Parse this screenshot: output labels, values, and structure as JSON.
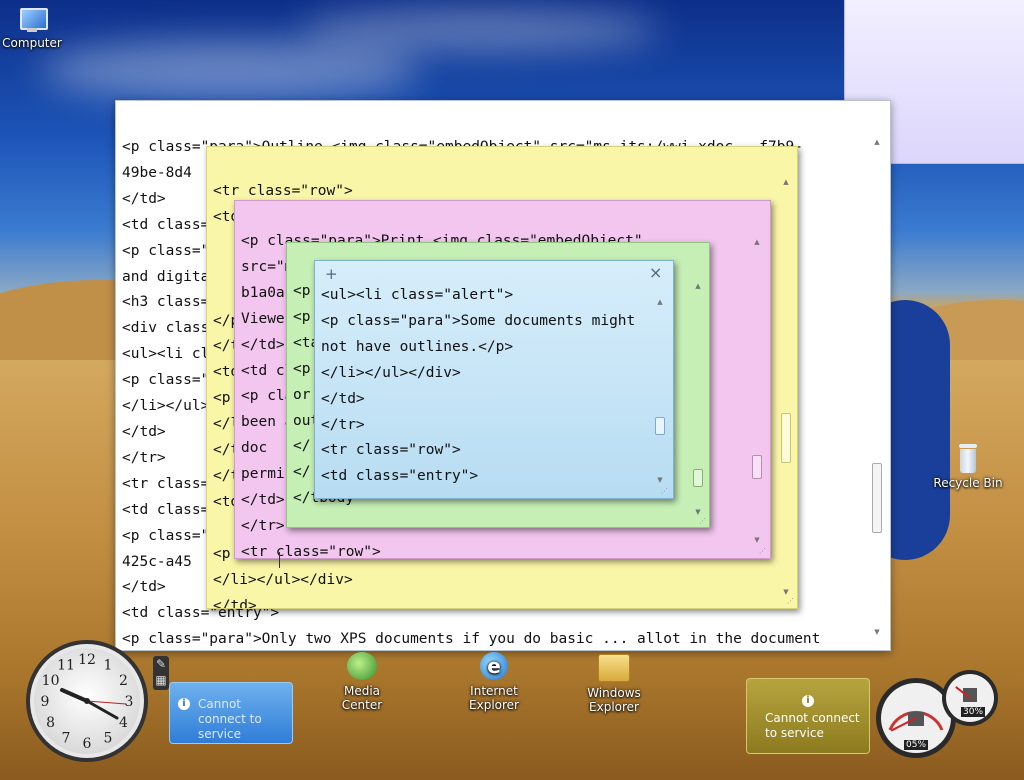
{
  "desktop": {
    "icons": {
      "computer": "Computer",
      "recycle_bin": "Recycle Bin",
      "media_center": "Media Center",
      "internet_explorer": "Internet Explorer",
      "windows_explorer": "Windows Explorer"
    }
  },
  "main_window": {
    "lines": [
      "<p class=\"para\">Outline <img class=\"embedObject\" src=\"ms-its:/wwi.xdoc...f7b9-",
      "49be-8d4                                                              p>",
      "</td>",
      "<td class=\"e",
      "<p class=\"pa                                                          results",
      "and digital",
      "<h3 class=\"",
      "<div class=\"",
      "<ul><li clas",
      "<p class=\"pa",
      "</li></ul></",
      "</td>",
      "</tr>",
      "<tr class=\"r",
      "<td class=\"e",
      "<p class=\"pa                                                       f37f-",
      "425c-a45",
      "</td>",
      "<td class=\"entry\">",
      "<p class=\"para\">Only two XPS documents if you do basic ... allot in the document"
    ]
  },
  "note_yellow": {
    "lines": [
      "<tr class=\"row\">",
      "<td",
      "",
      "",
      "",
      "</p",
      "</t",
      "<td",
      "<p",
      "</l",
      "</td",
      "</tr",
      "<td",
      "",
      "<p",
      "</li></ul></div>",
      "</td>"
    ]
  },
  "note_pink": {
    "lines": [
      "<p class=\"para\">Print <img class=\"embedObject\"",
      "src=\"m",
      "b1a0a",
      "Viewe",
      "</td>",
      "<td cl",
      "<p cla",
      "been a",
      "doc",
      "permi",
      "</td>",
      "</tr>",
      "<tr class=\"row\">"
    ]
  },
  "note_green": {
    "lines": [
      "<p",
      "<p",
      "<ta",
      "<p",
      "or",
      "out",
      "</",
      "</",
      "</tbody"
    ]
  },
  "note_blue": {
    "add_label": "+",
    "close_label": "×",
    "lines": [
      "<ul><li class=\"alert\">",
      "<p class=\"para\">Some documents might",
      "not have outlines.</p>",
      "</li></ul></div>",
      "</td>",
      "</tr>",
      "<tr class=\"row\">",
      "<td class=\"entry\">"
    ]
  },
  "gadgets": {
    "feed_left": {
      "info_icon": "i",
      "message": "Cannot connect to service"
    },
    "feed_right": {
      "info_icon": "i",
      "message": "Cannot connect to service"
    },
    "cpu_meter": {
      "cpu_percent": "05%",
      "ram_percent": "30%",
      "cpu_value": 0.05,
      "ram_value": 0.3
    },
    "clock": {
      "numerals": [
        "12",
        "1",
        "2",
        "3",
        "4",
        "5",
        "6",
        "7",
        "8",
        "9",
        "10",
        "11"
      ]
    }
  },
  "colors": {
    "yellow_note": "#faf6a8",
    "pink_note": "#f2c6ee",
    "green_note": "#c6efb6",
    "blue_note": "#c4e3f5"
  }
}
